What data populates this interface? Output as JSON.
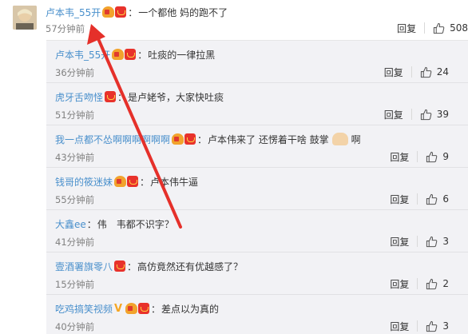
{
  "root": {
    "user": "卢本韦_55开",
    "colon": "：",
    "text": "一个都他 妈的跑不了",
    "time": "57分钟前",
    "reply_label": "回复",
    "likes": "508"
  },
  "replies": [
    {
      "user": "卢本韦_55开",
      "badges": [
        "gift",
        "red"
      ],
      "colon": "：",
      "text": "吐痰的一律拉黑",
      "time": "36分钟前",
      "reply_label": "回复",
      "likes": "24"
    },
    {
      "user": "虎牙舌吻怪",
      "badges": [
        "red"
      ],
      "colon": "：",
      "text": "是卢姥爷，大家快吐痰",
      "time": "51分钟前",
      "reply_label": "回复",
      "likes": "39"
    },
    {
      "user": "我一点都不怂啊啊啊啊啊啊",
      "badges": [
        "gift",
        "red"
      ],
      "colon": "：",
      "text": "卢本伟来了 还愣着干啥 鼓掌",
      "text_after": "啊",
      "time": "43分钟前",
      "reply_label": "回复",
      "likes": "9"
    },
    {
      "user": "钱哥的筱迷妹",
      "badges": [
        "gift",
        "red"
      ],
      "colon": "：",
      "text": "卢本伟牛逼",
      "time": "55分钟前",
      "reply_label": "回复",
      "likes": "6"
    },
    {
      "user": "大鑫ee",
      "badges": [],
      "colon": "：",
      "text": "伟　韦都不识字？",
      "time": "41分钟前",
      "reply_label": "回复",
      "likes": "3"
    },
    {
      "user": "壹酒署旗零八",
      "badges": [
        "red"
      ],
      "colon": "：",
      "text": "高仿竟然还有优越感了？",
      "time": "15分钟前",
      "reply_label": "回复",
      "likes": "2"
    },
    {
      "user": "吃鸡搞笑视频",
      "badges": [
        "v",
        "gift",
        "red"
      ],
      "colon": "：",
      "text": "差点以为真的",
      "time": "40分钟前",
      "reply_label": "回复",
      "likes": "3"
    }
  ],
  "icons": {
    "like": "thumbs-up-icon",
    "clap": "clapping-hands-icon",
    "annotation": "red-arrow-annotation"
  },
  "colors": {
    "username": "#4a90cc",
    "arrow": "#e5302a",
    "reply_bg": "#f2f2f5"
  }
}
